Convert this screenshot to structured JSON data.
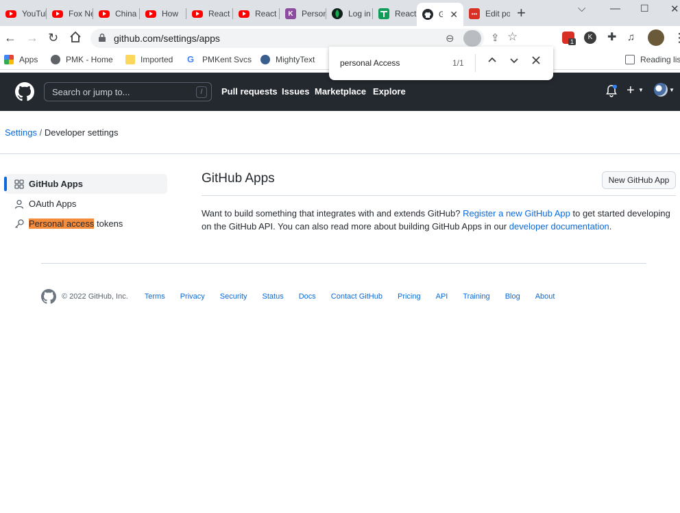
{
  "browser": {
    "tabs": [
      {
        "title": "YouTube"
      },
      {
        "title": "Fox News"
      },
      {
        "title": "China"
      },
      {
        "title": "How"
      },
      {
        "title": "React"
      },
      {
        "title": "React"
      },
      {
        "title": "Personal"
      },
      {
        "title": "Log in"
      },
      {
        "title": "React"
      },
      {
        "title": "GitHub"
      },
      {
        "title": "Edit post"
      }
    ],
    "url": "github.com/settings/apps",
    "ext_badge": "1",
    "bookmarks": [
      "Apps",
      "PMK - Home",
      "Imported",
      "PMKent Svcs",
      "MightyText"
    ],
    "reading_list": "Reading list",
    "find": {
      "query": "personal Access",
      "count": "1/1"
    }
  },
  "header": {
    "search_placeholder": "Search or jump to...",
    "search_shortcut": "/",
    "nav": [
      "Pull requests",
      "Issues",
      "Marketplace",
      "Explore"
    ],
    "plus": "+"
  },
  "breadcrumb": {
    "root": "Settings",
    "sep": "/",
    "current": "Developer settings"
  },
  "sidebar": {
    "items": [
      {
        "label": "GitHub Apps"
      },
      {
        "label": "OAuth Apps"
      },
      {
        "label_highlight": "Personal access",
        "label_rest": " tokens"
      }
    ]
  },
  "main": {
    "title": "GitHub Apps",
    "new_button": "New GitHub App",
    "desc_1": "Want to build something that integrates with and extends GitHub? ",
    "link_register": "Register a new GitHub App",
    "desc_2": " to get started developing on the GitHub API. You can also read more about building GitHub Apps in our ",
    "link_docs": "developer documentation",
    "desc_3": "."
  },
  "footer": {
    "copyright": "© 2022 GitHub, Inc.",
    "links": [
      "Terms",
      "Privacy",
      "Security",
      "Status",
      "Docs",
      "Contact GitHub",
      "Pricing",
      "API",
      "Training",
      "Blog",
      "About"
    ]
  },
  "colors": {
    "header_bg": "#24292f",
    "link": "#0969da",
    "find_highlight": "#f48c3c",
    "youtube": "#ff0000"
  }
}
